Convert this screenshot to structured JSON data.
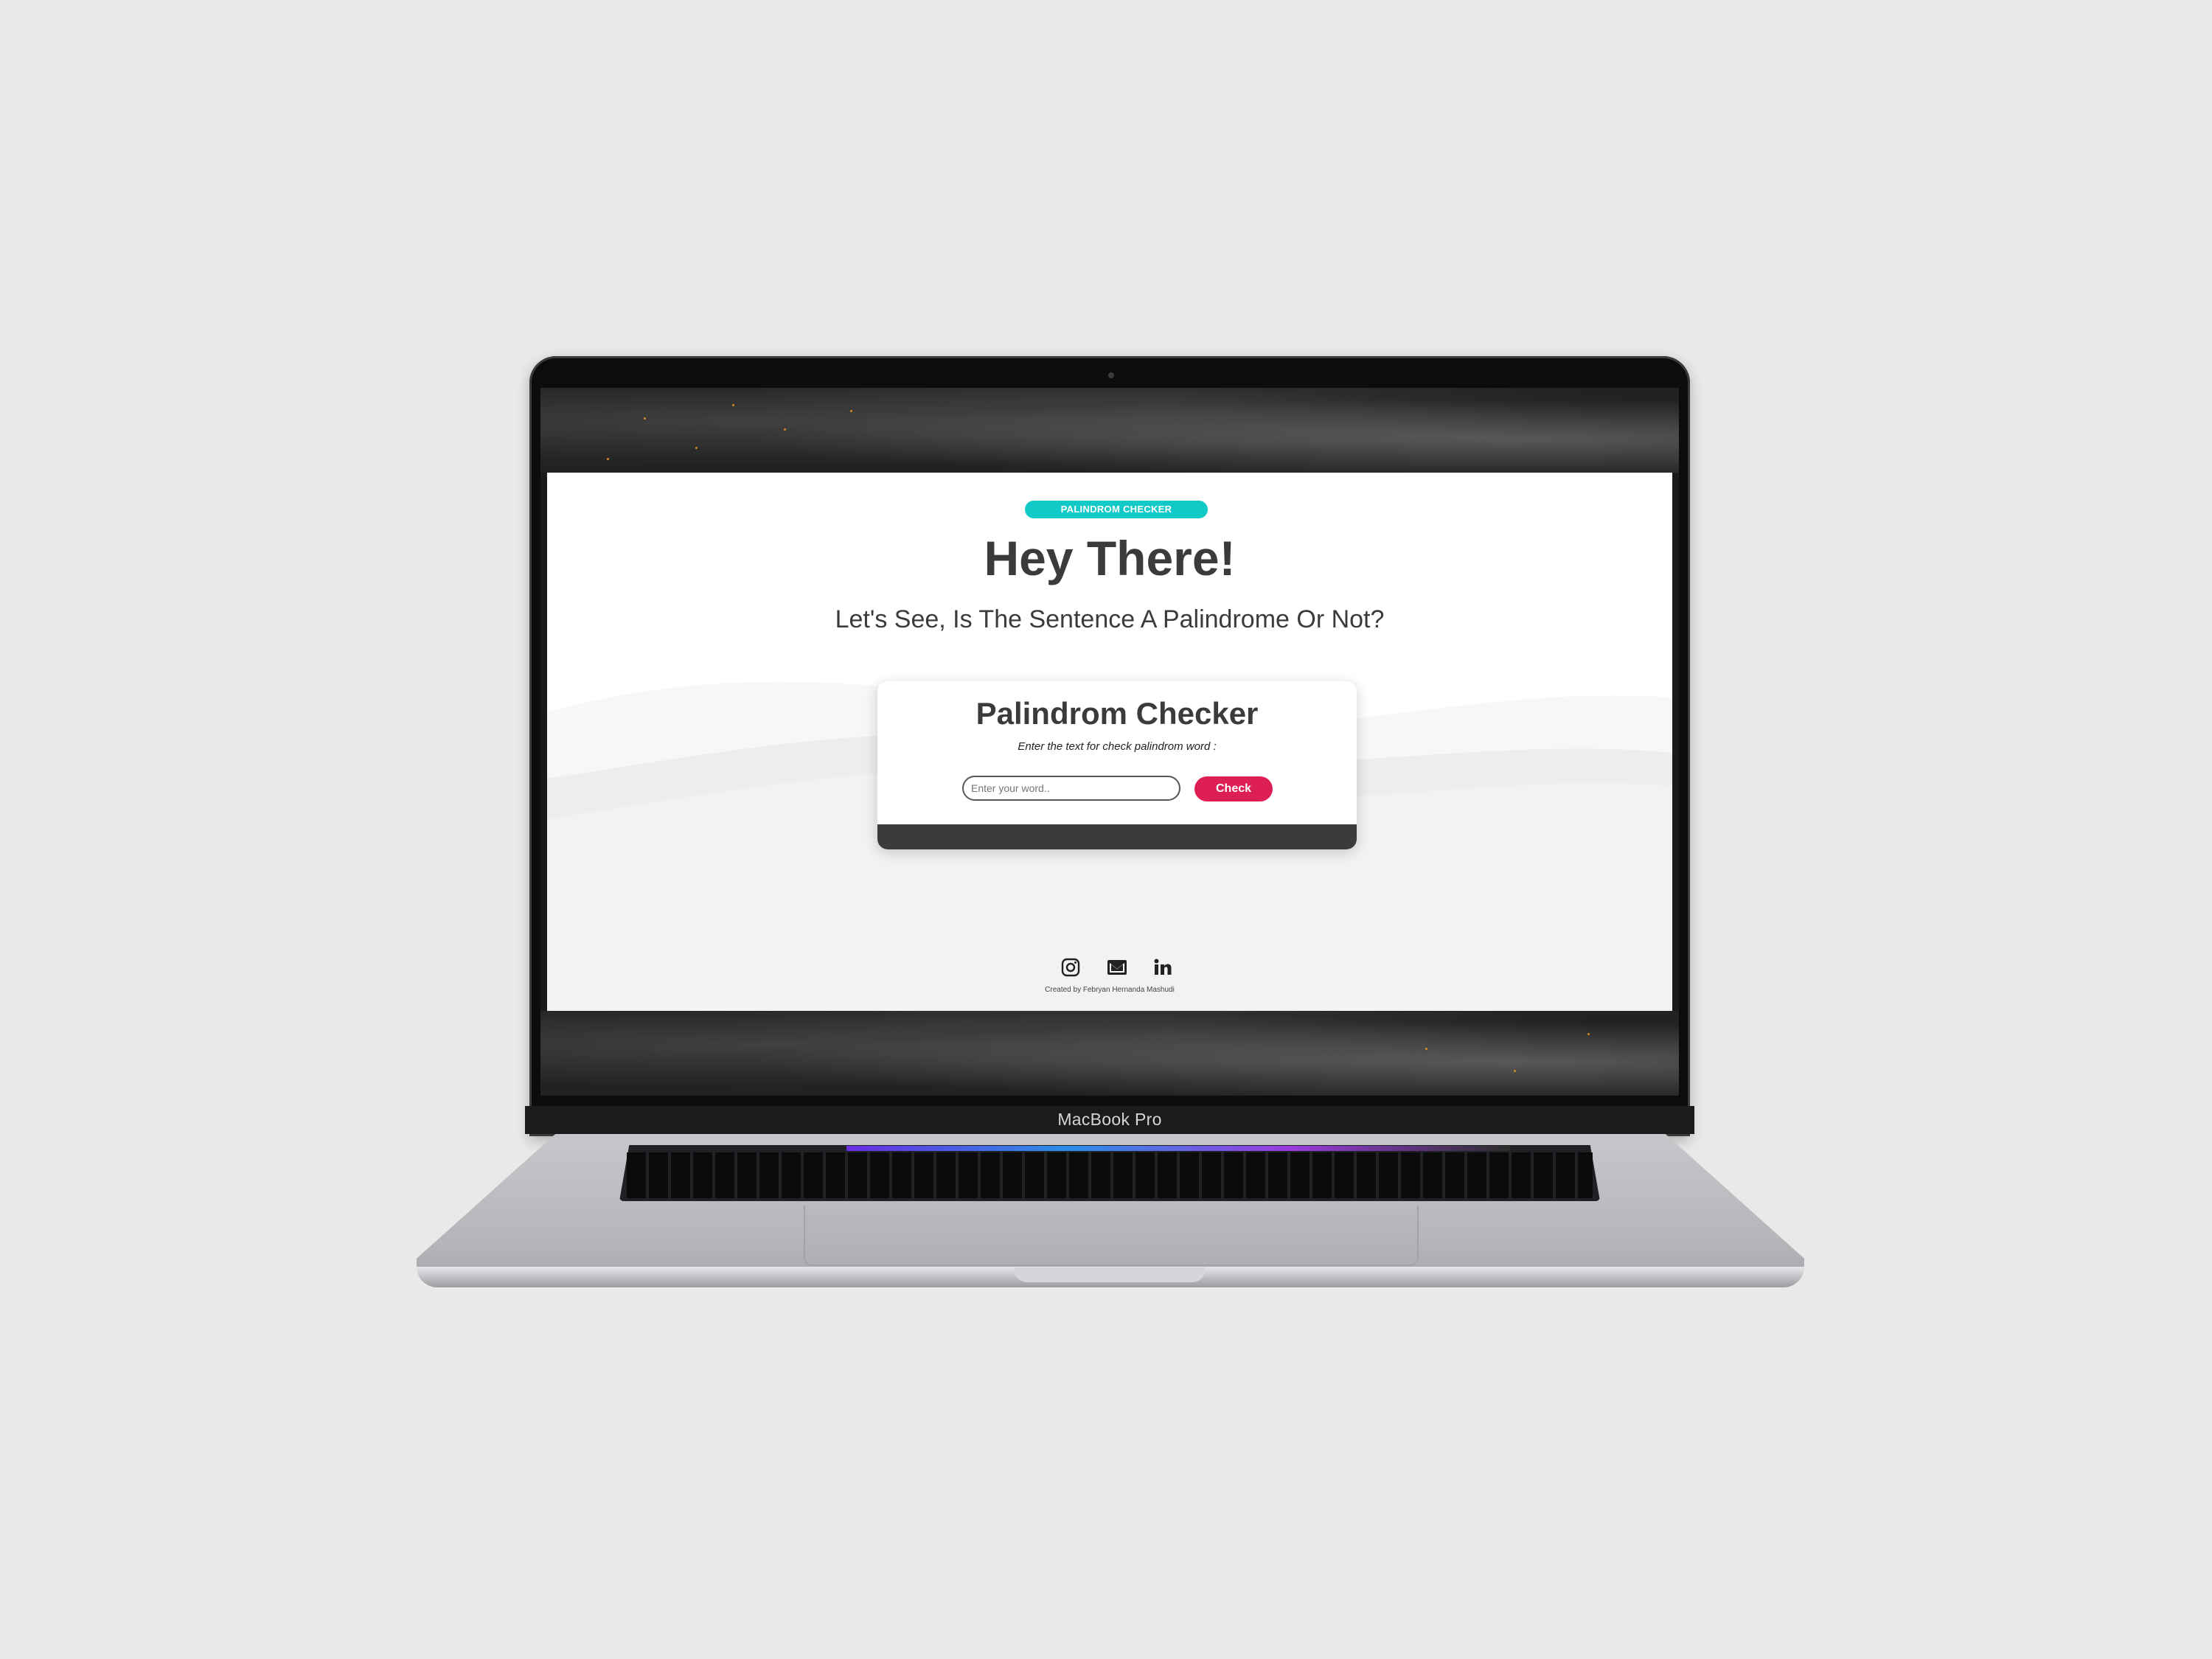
{
  "page": {
    "badge": "PALINDROM CHECKER",
    "hero_title": "Hey There!",
    "hero_subtitle": "Let's See, Is The Sentence A Palindrome Or Not?"
  },
  "checker": {
    "title": "Palindrom Checker",
    "hint": "Enter the text for check palindrom word :",
    "input_placeholder": "Enter your word..",
    "input_value": "",
    "button_label": "Check"
  },
  "footer": {
    "social_icons": [
      "instagram-icon",
      "mail-icon",
      "linkedin-icon"
    ],
    "credit": "Created by Febryan Hernanda Mashudi"
  },
  "device": {
    "brand_label": "MacBook Pro"
  },
  "colors": {
    "accent_teal": "#11c9c6",
    "button_red": "#de1f55",
    "text_dark": "#3b3b3b"
  }
}
